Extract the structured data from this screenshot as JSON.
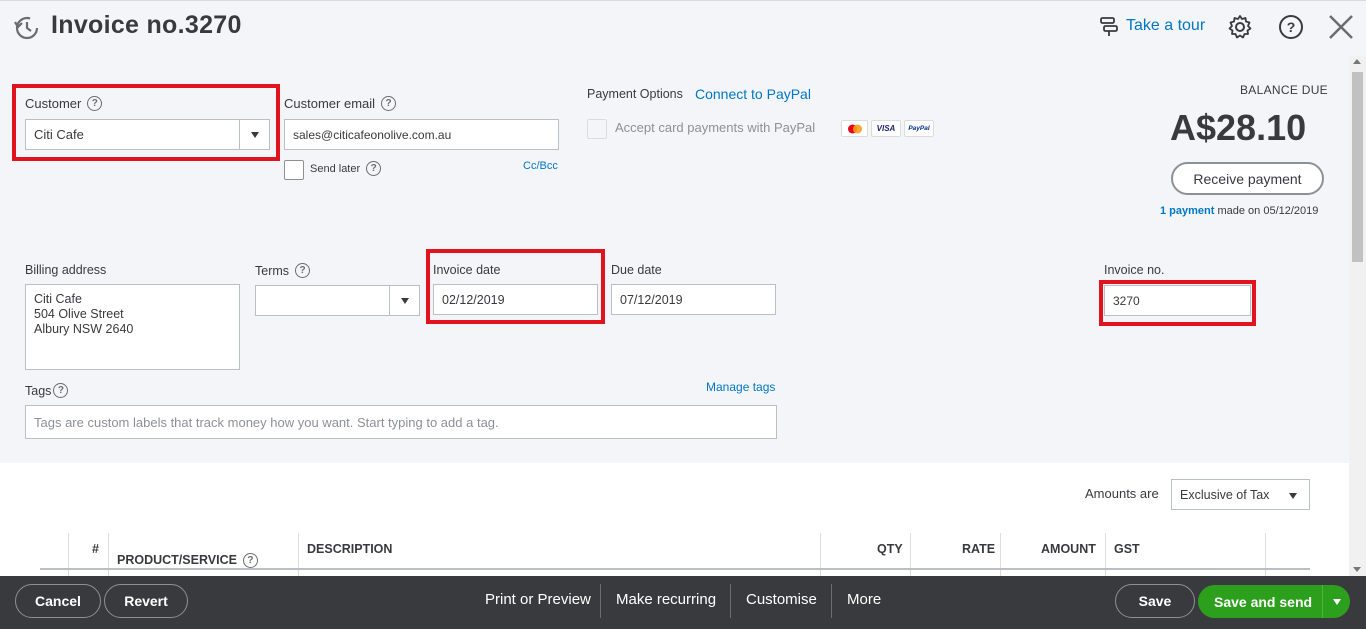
{
  "header": {
    "title": "Invoice no.3270",
    "take_tour": "Take a tour"
  },
  "customer": {
    "label": "Customer",
    "value": "Citi Cafe"
  },
  "email": {
    "label": "Customer email",
    "value": "sales@citicafeonolive.com.au",
    "send_later": "Send later",
    "cc_bcc": "Cc/Bcc"
  },
  "payment_options": {
    "label": "Payment Options",
    "connect_link": "Connect to PayPal",
    "accept_label": "Accept card payments with PayPal",
    "cards": [
      "",
      "VISA",
      "PayPal"
    ]
  },
  "balance": {
    "label": "BALANCE DUE",
    "amount": "A$28.10",
    "receive_button": "Receive payment",
    "payment_link": "1 payment",
    "payment_note": "made on 05/12/2019"
  },
  "billing": {
    "label": "Billing address",
    "lines": [
      "Citi Cafe",
      "504 Olive Street",
      "Albury NSW  2640"
    ]
  },
  "terms": {
    "label": "Terms",
    "value": ""
  },
  "invoice_date": {
    "label": "Invoice date",
    "value": "02/12/2019"
  },
  "due_date": {
    "label": "Due date",
    "value": "07/12/2019"
  },
  "invoice_no": {
    "label": "Invoice no.",
    "value": "3270"
  },
  "tags": {
    "label": "Tags",
    "manage": "Manage tags",
    "placeholder": "Tags are custom labels that track money how you want. Start typing to add a tag."
  },
  "amounts": {
    "label": "Amounts are",
    "value": "Exclusive of Tax"
  },
  "table": {
    "columns": [
      "#",
      "PRODUCT/SERVICE",
      "DESCRIPTION",
      "QTY",
      "RATE",
      "AMOUNT",
      "GST"
    ]
  },
  "footer": {
    "cancel": "Cancel",
    "revert": "Revert",
    "print": "Print or Preview",
    "recurring": "Make recurring",
    "customise": "Customise",
    "more": "More",
    "save": "Save",
    "save_send": "Save and send"
  },
  "colors": {
    "accent": "#0077c5",
    "primary_green": "#2ca01c",
    "highlight_red": "#e0141e",
    "footer_bg": "#393a3d"
  }
}
